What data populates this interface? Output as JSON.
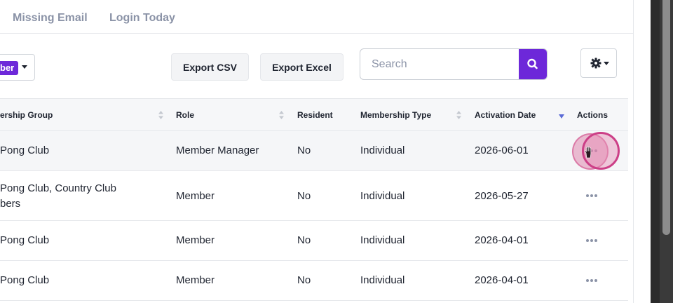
{
  "tabs": [
    {
      "label": "Missing Email"
    },
    {
      "label": "Login Today"
    }
  ],
  "toolbar": {
    "filter_chip_label": "ber",
    "export_csv_label": "Export CSV",
    "export_excel_label": "Export Excel",
    "search_placeholder": "Search",
    "search_value": ""
  },
  "table": {
    "columns": [
      {
        "label": "ership Group",
        "sortable": true
      },
      {
        "label": "Role",
        "sortable": true
      },
      {
        "label": "Resident",
        "sortable": false
      },
      {
        "label": "Membership Type",
        "sortable": true
      },
      {
        "label": "Activation Date",
        "sortable": true,
        "sort_direction": "descending"
      },
      {
        "label": "Actions",
        "sortable": false
      }
    ],
    "rows": [
      {
        "group": "Pong Club",
        "role": "Member Manager",
        "resident": "No",
        "type": "Individual",
        "activation": "2026-06-01"
      },
      {
        "group": "Pong Club, Country Club\nbers",
        "role": "Member",
        "resident": "No",
        "type": "Individual",
        "activation": "2026-05-27"
      },
      {
        "group": "Pong Club",
        "role": "Member",
        "resident": "No",
        "type": "Individual",
        "activation": "2026-04-01"
      },
      {
        "group": "Pong Club",
        "role": "Member",
        "resident": "No",
        "type": "Individual",
        "activation": "2026-04-01"
      }
    ]
  },
  "colors": {
    "accent": "#6d28d9",
    "muted_text": "#8b93a7",
    "click_indicator": "#cc3f87"
  },
  "icons": {
    "search_button": "search-icon",
    "settings_button": "gear-icon",
    "row_actions": "ellipsis-icon",
    "pointer": "hand-cursor-icon"
  }
}
